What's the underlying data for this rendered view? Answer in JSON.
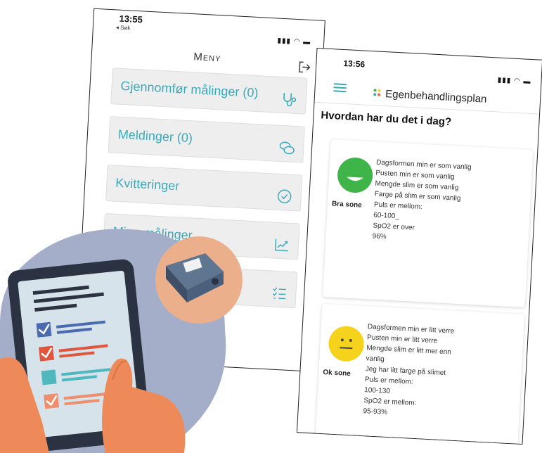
{
  "menu_screen": {
    "status": {
      "time": "13:55",
      "back": "◂ Søk"
    },
    "title": "Meny",
    "items": [
      {
        "label": "Gjennomfør målinger (0)",
        "icon": "stethoscope-icon"
      },
      {
        "label": "Meldinger (0)",
        "icon": "chat-bubbles-icon"
      },
      {
        "label": "Kvitteringer",
        "icon": "check-circle-icon"
      },
      {
        "label": "Mine målinger",
        "icon": "chart-icon"
      },
      {
        "label": "",
        "icon": "checklist-icon"
      }
    ]
  },
  "plan_screen": {
    "status": {
      "time": "13:56"
    },
    "header": "Egenbehandlingsplan",
    "question": "Hvordan har du det i dag?",
    "zones": [
      {
        "name": "Bra sone",
        "color": "#3fb549",
        "lines": [
          "Dagsformen min er som vanlig",
          "Pusten min er som vanlig",
          "Mengde slim er som vanlig",
          "Farge på slim er som vanlig",
          "Puls er mellom:",
          "60-100_",
          "SpO2 er over",
          "96%"
        ]
      },
      {
        "name": "Ok sone",
        "color": "#f5d21c",
        "lines": [
          "Dagsformen min er litt verre",
          "Pusten min er litt verre",
          "Mengde slim er litt mer enn",
          "vanlig",
          "Jeg har litt farge på slimet",
          "Puls er mellom:",
          "100-130",
          "SpO2 er mellom:",
          "95-93%"
        ]
      }
    ]
  },
  "colors": {
    "accent": "#3aaab9",
    "menu_bg": "#eeeeee"
  }
}
